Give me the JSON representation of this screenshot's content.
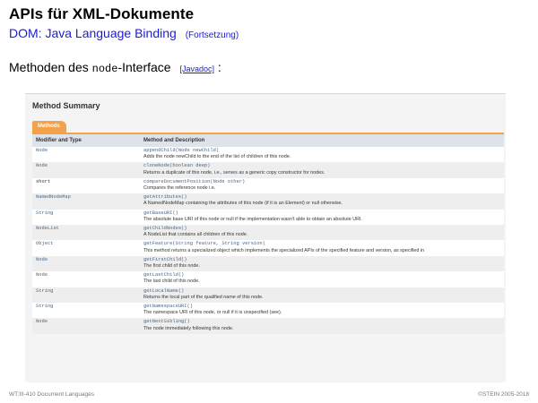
{
  "slide": {
    "title": "APIs für XML-Dokumente",
    "subtitle": "DOM: Java Language Binding",
    "subtitle_note": "(Fortsetzung)",
    "intro_prefix": "Methoden des ",
    "intro_code": "node",
    "intro_suffix": "-Interface ",
    "intro_link": "[Javadoc]",
    "intro_colon": " :"
  },
  "summary": {
    "heading": "Method Summary",
    "tab_label": "Methods",
    "col_type": "Modifier and Type",
    "col_method": "Method and Description",
    "rows": [
      {
        "type": "Node",
        "sig": "appendChild(Node newChild)",
        "desc": "Adds the node newChild to the end of the list of children of this node."
      },
      {
        "type": "Node",
        "sig": "cloneNode(boolean deep)",
        "desc": "Returns a duplicate of this node, i.e., serves as a generic copy constructor for nodes."
      },
      {
        "type": "short",
        "sig": "compareDocumentPosition(Node other)",
        "desc": "Compares the reference node i.e."
      },
      {
        "type": "NamedNodeMap",
        "sig": "getAttributes()",
        "desc": "A NamedNodeMap containing the attributes of this node (if it is an Element) or null otherwise."
      },
      {
        "type": "String",
        "sig": "getBaseURI()",
        "desc": "The absolute base URI of this node or null if the implementation wasn't able to obtain an absolute URI."
      },
      {
        "type": "NodeList",
        "sig": "getChildNodes()",
        "desc": "A NodeList that contains all children of this node."
      },
      {
        "type": "Object",
        "sig": "getFeature(String feature, String version)",
        "desc": "This method returns a specialized object which implements the specialized APIs of the specified feature and version, as specified in"
      },
      {
        "type": "Node",
        "sig": "getFirstChild()",
        "desc": "The first child of this node."
      },
      {
        "type": "Node",
        "sig": "getLastChild()",
        "desc": "The last child of this node."
      },
      {
        "type": "String",
        "sig": "getLocalName()",
        "desc": "Returns the local part of the qualified name of this node."
      },
      {
        "type": "String",
        "sig": "getNamespaceURI()",
        "desc": "The namespace URI of this node, or null if it is unspecified (see)."
      },
      {
        "type": "Node",
        "sig": "getNextSibling()",
        "desc": "The node immediately following this node."
      }
    ]
  },
  "footer": {
    "left": "WT:III-410    Document Languages",
    "right": "©STEIN 2005-2018"
  }
}
